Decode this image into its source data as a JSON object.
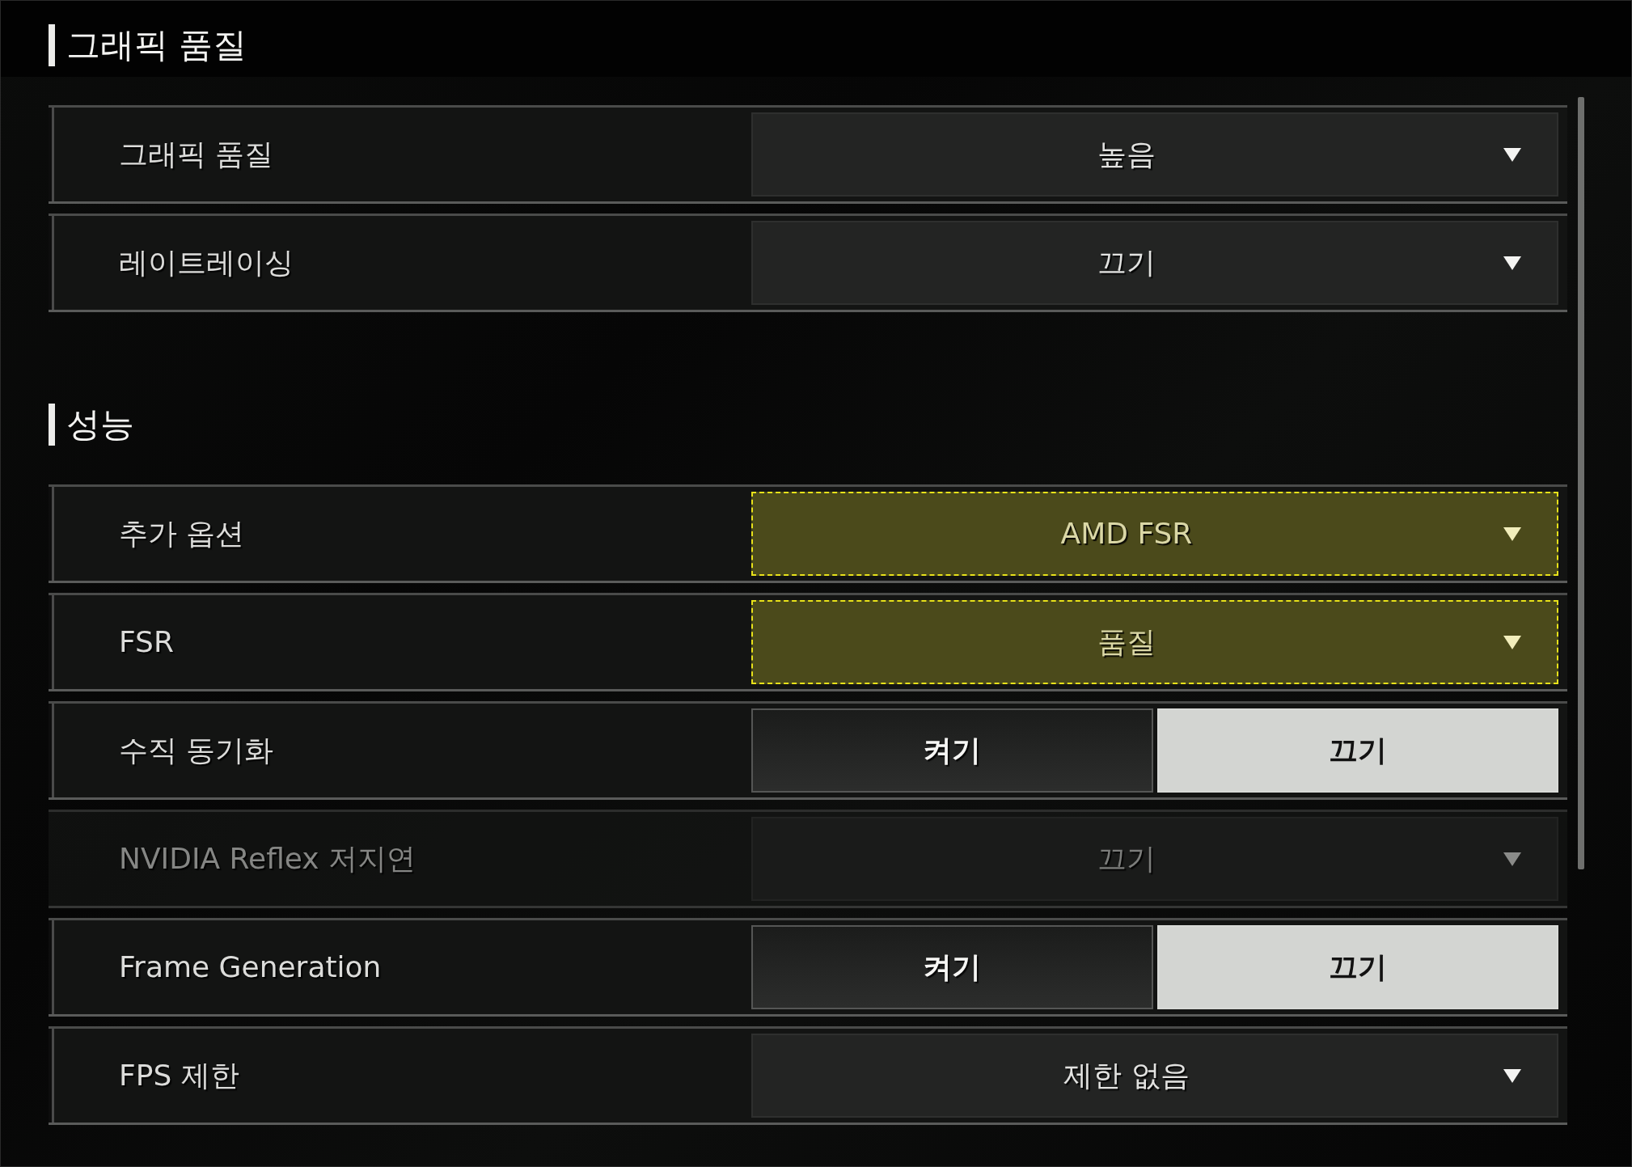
{
  "sections": [
    {
      "title": "그래픽 품질",
      "settings": [
        {
          "kind": "dropdown",
          "label": "그래픽 품질",
          "value": "높음",
          "highlighted": false,
          "disabled": false
        },
        {
          "kind": "dropdown",
          "label": "레이트레이싱",
          "value": "끄기",
          "highlighted": false,
          "disabled": false
        }
      ]
    },
    {
      "title": "성능",
      "settings": [
        {
          "kind": "dropdown",
          "label": "추가 옵션",
          "value": "AMD FSR",
          "highlighted": true,
          "disabled": false
        },
        {
          "kind": "dropdown",
          "label": "FSR",
          "value": "품질",
          "highlighted": true,
          "disabled": false
        },
        {
          "kind": "toggle",
          "label": "수직 동기화",
          "options": [
            {
              "label": "켜기",
              "selected": false
            },
            {
              "label": "끄기",
              "selected": true
            }
          ],
          "highlighted": false,
          "disabled": false
        },
        {
          "kind": "dropdown",
          "label": "NVIDIA Reflex 저지연",
          "value": "끄기",
          "highlighted": false,
          "disabled": true
        },
        {
          "kind": "toggle",
          "label": "Frame Generation",
          "options": [
            {
              "label": "켜기",
              "selected": false
            },
            {
              "label": "끄기",
              "selected": true
            }
          ],
          "highlighted": false,
          "disabled": false
        },
        {
          "kind": "dropdown",
          "label": "FPS 제한",
          "value": "제한 없음",
          "highlighted": false,
          "disabled": false
        }
      ]
    }
  ]
}
